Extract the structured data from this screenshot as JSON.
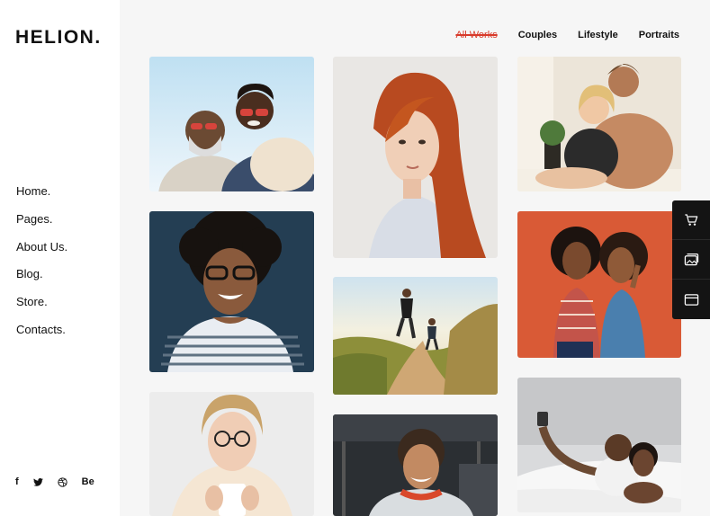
{
  "brand": {
    "logo": "HELION."
  },
  "nav": {
    "items": [
      {
        "label": "Home."
      },
      {
        "label": "Pages."
      },
      {
        "label": "About Us."
      },
      {
        "label": "Blog."
      },
      {
        "label": "Store."
      },
      {
        "label": "Contacts."
      }
    ]
  },
  "social": {
    "items": [
      {
        "label": "f",
        "icon": "facebook-icon"
      },
      {
        "label": "",
        "icon": "twitter-icon"
      },
      {
        "label": "",
        "icon": "dribbble-icon"
      },
      {
        "label": "Be",
        "icon": "behance-icon"
      }
    ]
  },
  "filters": {
    "items": [
      {
        "label": "All Works",
        "active": true
      },
      {
        "label": "Couples",
        "active": false
      },
      {
        "label": "Lifestyle",
        "active": false
      },
      {
        "label": "Portraits",
        "active": false
      }
    ]
  },
  "gallery": {
    "tiles": [
      {
        "subject": "smiling-couple-sunglasses",
        "sky": "#cfe6f3"
      },
      {
        "subject": "red-haired-woman-portrait",
        "sky": "#e9e7e4"
      },
      {
        "subject": "couple-on-sofa",
        "sky": "#e8e1d6"
      },
      {
        "subject": "woman-glasses-curly-hair",
        "sky": "#243e53"
      },
      {
        "subject": "runners-on-trail",
        "sky": "#dfe9ee"
      },
      {
        "subject": "two-women-orange-wall",
        "sky": "#d95a36"
      },
      {
        "subject": "woman-with-mug",
        "sky": "#ececec"
      },
      {
        "subject": "man-headphones-gym",
        "sky": "#2b2f33"
      },
      {
        "subject": "couple-selfie-bed",
        "sky": "#d9dadc"
      }
    ]
  },
  "tools": {
    "items": [
      {
        "icon": "cart-icon"
      },
      {
        "icon": "gallery-icon"
      },
      {
        "icon": "window-icon"
      }
    ]
  },
  "colors": {
    "accent": "#d83a2a",
    "dark": "#141414"
  }
}
